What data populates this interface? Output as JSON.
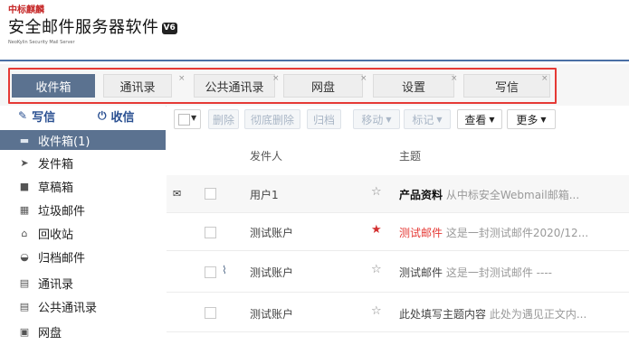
{
  "brand": {
    "top": "中标麒麟",
    "title": "安全邮件服务器软件",
    "version_badge": "V6",
    "subtitle": "NeoKylin Security Mail Server"
  },
  "tabs": [
    {
      "label": "收件箱",
      "active": true
    },
    {
      "label": "通讯录"
    },
    {
      "label": "公共通讯录"
    },
    {
      "label": "网盘"
    },
    {
      "label": "设置"
    },
    {
      "label": "写信"
    }
  ],
  "tab_close_glyph": "×",
  "sidebar": {
    "compose_label": "写信",
    "receive_label": "收信",
    "items": [
      {
        "label": "收件箱(1)",
        "icon": "inbox-icon",
        "active": true
      },
      {
        "label": "发件箱",
        "icon": "send-icon"
      },
      {
        "label": "草稿箱",
        "icon": "draft-icon"
      },
      {
        "label": "垃圾邮件",
        "icon": "spam-icon"
      },
      {
        "label": "回收站",
        "icon": "trash-icon"
      },
      {
        "label": "归档邮件",
        "icon": "archive-icon"
      },
      {
        "label": "通讯录",
        "icon": "contacts-icon"
      },
      {
        "label": "公共通讯录",
        "icon": "public-contacts-icon"
      },
      {
        "label": "网盘",
        "icon": "netdisk-icon"
      }
    ]
  },
  "toolbar": {
    "delete": "删除",
    "perm_delete": "彻底删除",
    "archive": "归档",
    "move": "移动",
    "mark": "标记",
    "view": "查看",
    "more": "更多"
  },
  "list": {
    "col_sender": "发件人",
    "col_subject": "主题",
    "rows": [
      {
        "sender": "用户1",
        "subject": "产品资料",
        "preview": "从中标安全Webmail邮箱...",
        "unread": true,
        "starred": false,
        "attachment": false
      },
      {
        "sender": "测试账户",
        "subject": "测试邮件",
        "preview": "这是一封测试邮件2020/12...",
        "unread": false,
        "starred": true,
        "attachment": false
      },
      {
        "sender": "测试账户",
        "subject": "测试邮件",
        "preview": "这是一封测试邮件 ----",
        "unread": false,
        "starred": false,
        "attachment": true
      },
      {
        "sender": "测试账户",
        "subject": "此处填写主题内容",
        "preview": "此处为遇见正文内...",
        "unread": false,
        "starred": false,
        "attachment": false
      }
    ]
  },
  "colors": {
    "accent": "#5b7290",
    "highlight_box": "#e53935",
    "star": "#d32f2f",
    "link": "#294f91"
  }
}
